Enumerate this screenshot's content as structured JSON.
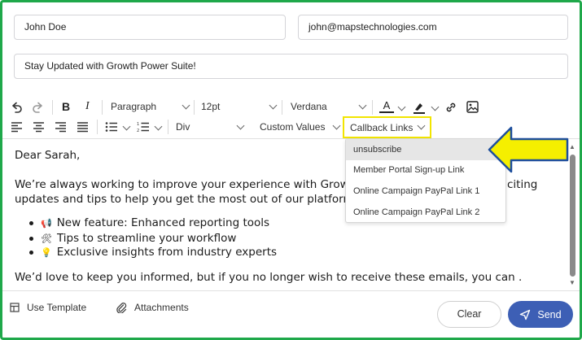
{
  "fields": {
    "name_value": "John Doe",
    "email_value": "john@mapstechnologies.com",
    "subject_value": "Stay Updated with Growth Power Suite!"
  },
  "toolbar": {
    "paragraph_select": "Paragraph",
    "size_select": "12pt",
    "font_select": "Verdana",
    "div_select": "Div",
    "custom_values": "Custom Values",
    "callback_links": "Callback Links"
  },
  "callback_menu": {
    "items": [
      "unsubscribe",
      "Member Portal Sign-up Link",
      "Online Campaign PayPal Link 1",
      "Online Campaign PayPal Link 2"
    ]
  },
  "editor": {
    "greeting": "Dear Sarah,",
    "para1_line1_start": "We’re always working to improve your experience with Growth",
    "para1_line1_end": "citing",
    "para1_line2": "updates and tips to help you get the most out of our platform.",
    "bullets": [
      {
        "emoji": "📢",
        "text": "New feature: Enhanced reporting tools"
      },
      {
        "emoji": "🛠",
        "text": "Tips to streamline your workflow"
      },
      {
        "emoji": "💡",
        "text": "Exclusive insights from industry experts"
      }
    ],
    "para2": "We’d love to keep you informed, but if you no longer wish to receive these emails, you can ."
  },
  "footer": {
    "use_template": "Use Template",
    "attachments": "Attachments",
    "clear": "Clear",
    "send": "Send"
  },
  "colors": {
    "frame_border": "#1fa84a",
    "highlight": "#f2e500",
    "send_button": "#3d5fb5"
  }
}
